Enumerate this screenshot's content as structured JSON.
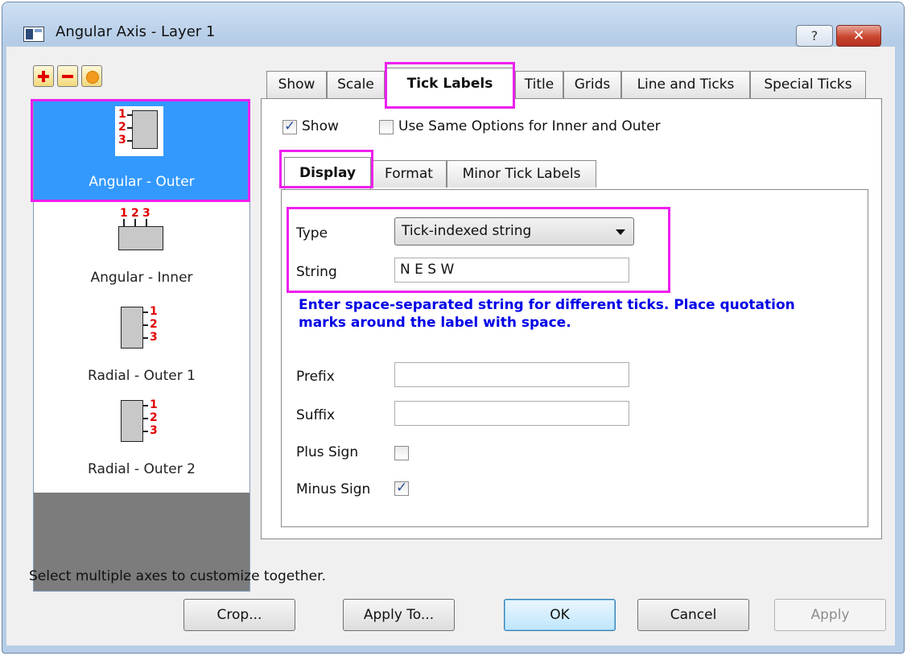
{
  "window": {
    "title": "Angular Axis - Layer 1",
    "help_label": "?",
    "close_label": "✕"
  },
  "toolbar": {
    "add_icon": "plus-icon",
    "remove_icon": "minus-icon",
    "reset_icon": "circle-icon"
  },
  "axis_list": {
    "items": [
      {
        "label": "Angular - Outer",
        "selected": true
      },
      {
        "label": "Angular - Inner",
        "selected": false
      },
      {
        "label": "Radial - Outer 1",
        "selected": false
      },
      {
        "label": "Radial - Outer 2",
        "selected": false
      }
    ],
    "icon_digits": [
      "1",
      "2",
      "3"
    ]
  },
  "tabs": [
    {
      "label": "Show"
    },
    {
      "label": "Scale"
    },
    {
      "label": "Tick Labels",
      "active": true
    },
    {
      "label": "Title"
    },
    {
      "label": "Grids"
    },
    {
      "label": "Line and Ticks"
    },
    {
      "label": "Special Ticks"
    }
  ],
  "show_checkbox": {
    "label": "Show",
    "checked": true
  },
  "same_options_checkbox": {
    "label": "Use Same Options for Inner and Outer",
    "checked": false
  },
  "subtabs": [
    {
      "label": "Display",
      "active": true
    },
    {
      "label": "Format"
    },
    {
      "label": "Minor Tick Labels"
    }
  ],
  "display": {
    "type_label": "Type",
    "type_value": "Tick-indexed string",
    "string_label": "String",
    "string_value": "N E S W",
    "hint": "Enter space-separated string for different ticks. Place quotation marks around the label with space.",
    "prefix_label": "Prefix",
    "prefix_value": "",
    "suffix_label": "Suffix",
    "suffix_value": "",
    "plus_sign_label": "Plus Sign",
    "plus_sign_checked": false,
    "minus_sign_label": "Minus Sign",
    "minus_sign_checked": true
  },
  "status_text": "Select multiple axes to customize together.",
  "buttons": {
    "crop": "Crop...",
    "apply_to": "Apply To...",
    "ok": "OK",
    "cancel": "Cancel",
    "apply": "Apply"
  },
  "colors": {
    "highlight": "#ee1fee",
    "selection": "#3399ff",
    "hint_text": "#0000e6",
    "icon_digits": "#e00000"
  }
}
